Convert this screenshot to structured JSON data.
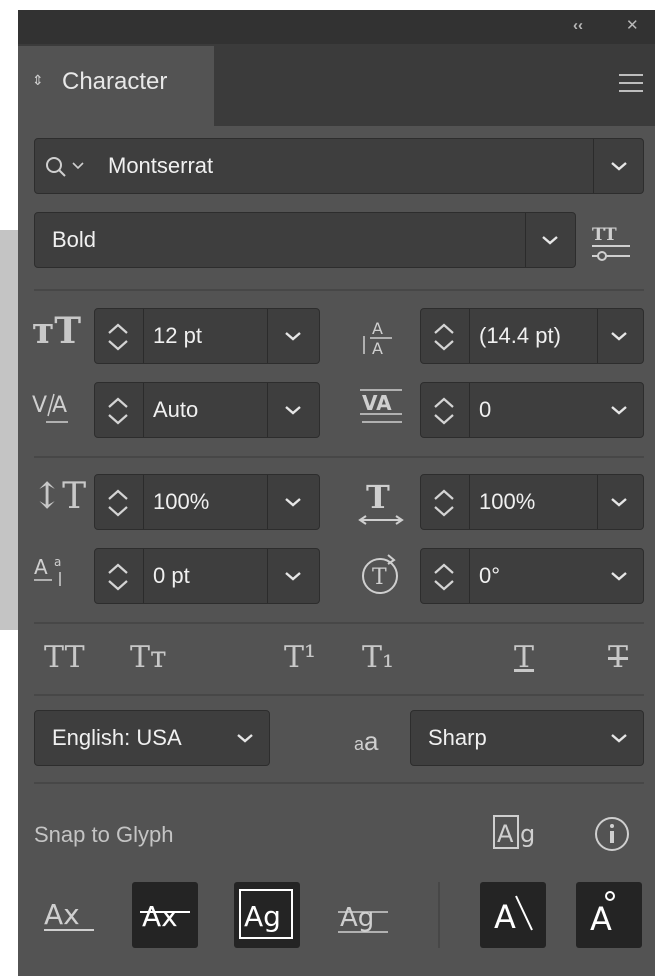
{
  "panel": {
    "title": "Character",
    "font_family": "Montserrat",
    "font_style": "Bold",
    "font_size": "12 pt",
    "leading": "(14.4 pt)",
    "kerning": "Auto",
    "tracking": "0",
    "vertical_scale": "100%",
    "horizontal_scale": "100%",
    "baseline_shift": "0 pt",
    "rotation": "0°",
    "language": "English: USA",
    "anti_aliasing": "Sharp",
    "snap_label": "Snap to Glyph"
  },
  "glyphs": {
    "all_caps": "TT",
    "small_caps": "Tт",
    "superscript": "T¹",
    "subscript": "T₁",
    "underline": "T",
    "strikethrough": "T",
    "aa_small": "a",
    "aa_big": "a"
  },
  "colors": {
    "panel_bg": "#535353",
    "field_bg": "#3e3e3e",
    "titlebar_bg": "#323232"
  }
}
